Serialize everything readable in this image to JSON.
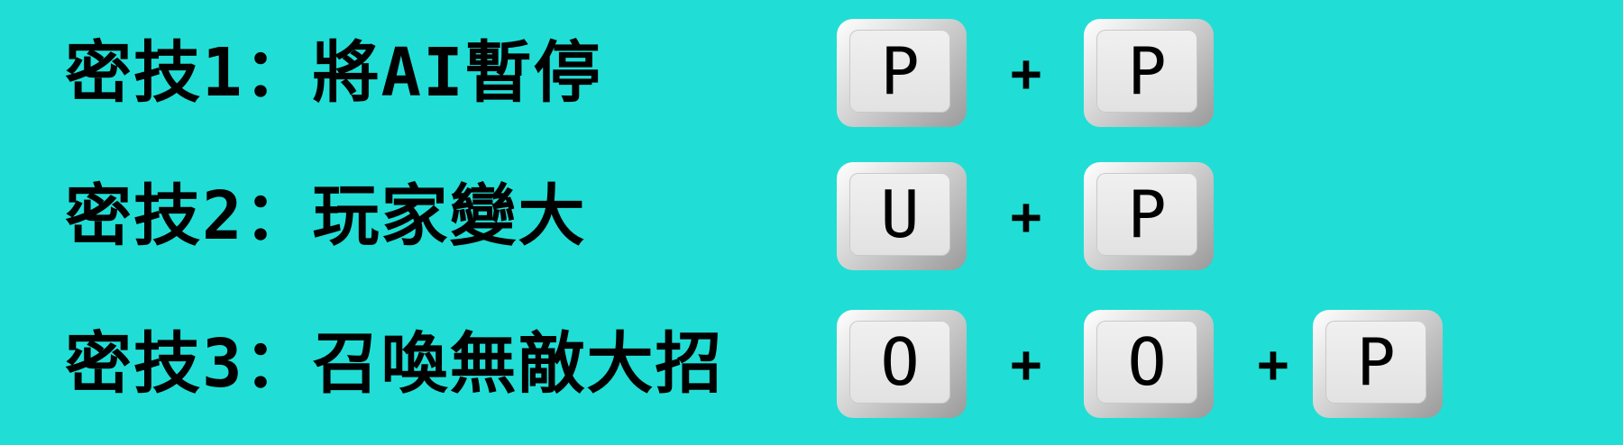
{
  "cheats": [
    {
      "label": "密技1：將AI暫停",
      "keys": [
        "P",
        "P"
      ],
      "plus": "+"
    },
    {
      "label": "密技2：玩家變大",
      "keys": [
        "U",
        "P"
      ],
      "plus": "+"
    },
    {
      "label": "密技3：召喚無敵大招",
      "keys": [
        "O",
        "O",
        "P"
      ],
      "plus": "+"
    }
  ],
  "colors": {
    "background": "#20ded5",
    "text": "#000000",
    "key": "#e2e2e2"
  },
  "icons": {
    "key": "keyboard-key-icon",
    "plus": "plus-icon"
  }
}
